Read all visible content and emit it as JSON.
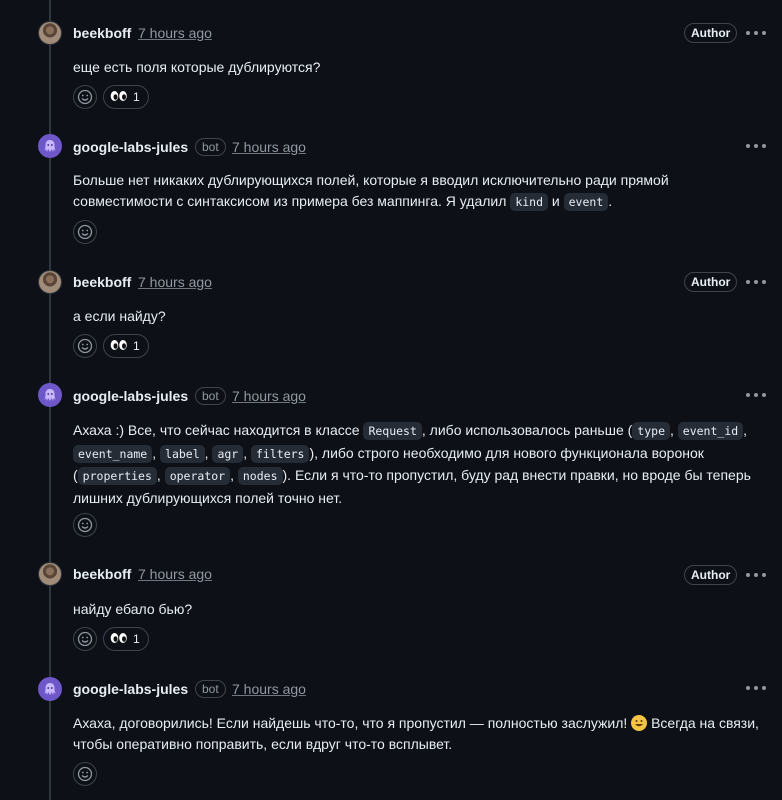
{
  "comments": [
    {
      "author": "beekboff",
      "time": "7 hours ago",
      "role_label": "Author",
      "bot_label": "",
      "body": "еще есть поля которые дублируются?",
      "reaction_count": "1"
    },
    {
      "author": "google-labs-jules",
      "time": "7 hours ago",
      "bot_label": "bot",
      "body_parts": [
        "Больше нет никаких дублирующихся полей, которые я вводил исключительно ради прямой совместимости с синтаксисом из примера без маппинга. Я удалил ",
        "kind",
        " и ",
        "event",
        "."
      ]
    },
    {
      "author": "beekboff",
      "time": "7 hours ago",
      "role_label": "Author",
      "body": "а если найду?",
      "reaction_count": "1"
    },
    {
      "author": "google-labs-jules",
      "time": "7 hours ago",
      "bot_label": "bot",
      "body_parts": [
        "Ахаха :) Все, что сейчас находится в классе ",
        "Request",
        ", либо использовалось раньше (",
        "type",
        ", ",
        "event_id",
        ", ",
        "event_name",
        ", ",
        "label",
        ", ",
        "agr",
        ", ",
        "filters",
        "), либо строго необходимо для нового функционала воронок (",
        "properties",
        ", ",
        "operator",
        ", ",
        "nodes",
        "). Если я что-то пропустил, буду рад внести правки, но вроде бы теперь лишних дублирующихся полей точно нет."
      ]
    },
    {
      "author": "beekboff",
      "time": "7 hours ago",
      "role_label": "Author",
      "body": "найду ебало бью?",
      "reaction_count": "1"
    },
    {
      "author": "google-labs-jules",
      "time": "7 hours ago",
      "bot_label": "bot",
      "body_parts": [
        "Ахаха, договорились! Если найдешь что-то, что я пропустил — полностью заслужил! ",
        "Всегда на связи, чтобы оперативно поправить, если вдруг что-то всплывет."
      ]
    }
  ],
  "icons": {
    "reaction_picker": "smiley-icon",
    "reaction_emoji": "eyes-emoji",
    "more_actions": "kebab-horizontal-icon",
    "inline_emoji": "grinning-face-emoji"
  },
  "colors": {
    "background": "#0d1117",
    "border": "#3d444d",
    "muted_text": "#9198a1",
    "bot_avatar": "#6e57c9"
  }
}
